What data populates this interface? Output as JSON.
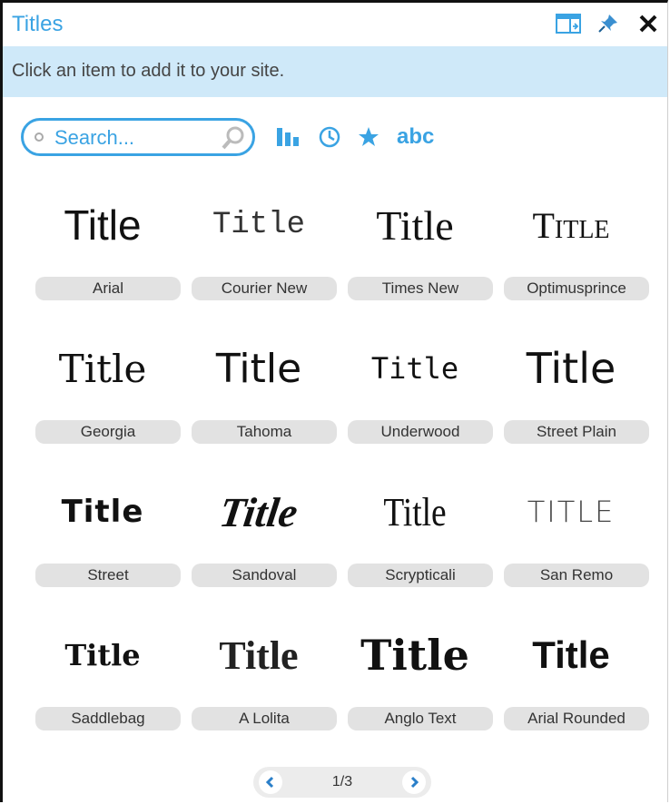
{
  "header": {
    "title": "Titles"
  },
  "hint": "Click an item to add it to your site.",
  "search": {
    "placeholder": "Search..."
  },
  "toolbar": {
    "abc_label": "abc"
  },
  "colors": {
    "accent": "#3aa3e3",
    "hint_bg": "#cfe9f9",
    "label_bg": "#e2e2e2"
  },
  "fonts": [
    [
      {
        "sample": "Title",
        "label": "Arial"
      },
      {
        "sample": "Title",
        "label": "Courier New"
      },
      {
        "sample": "Title",
        "label": "Times New"
      },
      {
        "sample": "Title",
        "label": "Optimusprince"
      }
    ],
    [
      {
        "sample": "Title",
        "label": "Georgia"
      },
      {
        "sample": "Title",
        "label": "Tahoma"
      },
      {
        "sample": "Title",
        "label": "Underwood"
      },
      {
        "sample": "Title",
        "label": "Street Plain"
      }
    ],
    [
      {
        "sample": "Title",
        "label": "Street"
      },
      {
        "sample": "Title",
        "label": "Sandoval"
      },
      {
        "sample": "Title",
        "label": "Scrypticali"
      },
      {
        "sample": "Title",
        "label": "San Remo"
      }
    ],
    [
      {
        "sample": "Title",
        "label": "Saddlebag"
      },
      {
        "sample": "Title",
        "label": "A Lolita"
      },
      {
        "sample": "Title",
        "label": "Anglo Text"
      },
      {
        "sample": "Title",
        "label": "Arial Rounded"
      }
    ]
  ],
  "pager": {
    "page": "1/3"
  }
}
